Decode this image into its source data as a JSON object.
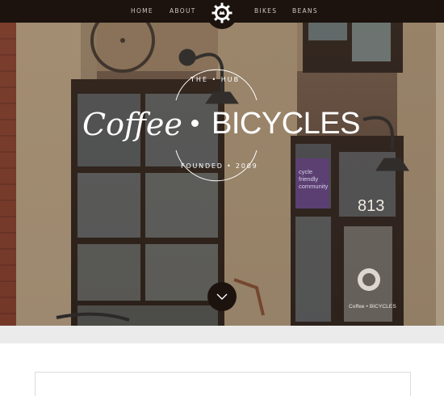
{
  "nav": {
    "home": "HOME",
    "about": "ABOUT",
    "bikes": "BIKES",
    "beans": "BEANS",
    "logo_icon": "gear-bike-logo-icon"
  },
  "hero": {
    "emblem_top": "THE • HUB",
    "emblem_left": "Coffee",
    "emblem_right": "BICYCLES",
    "emblem_bottom": "FOUNDED • 2009",
    "sign_line_1": "cycle",
    "sign_line_2": "friendly",
    "sign_line_3": "community",
    "door_number": "813",
    "door_logo_text": "Coffee • BICYCLES",
    "scroll_icon": "chevron-down-icon"
  },
  "colors": {
    "nav_bg": "#1c130e",
    "nav_text": "#cfc6bd",
    "band_bg": "#ebebeb"
  }
}
